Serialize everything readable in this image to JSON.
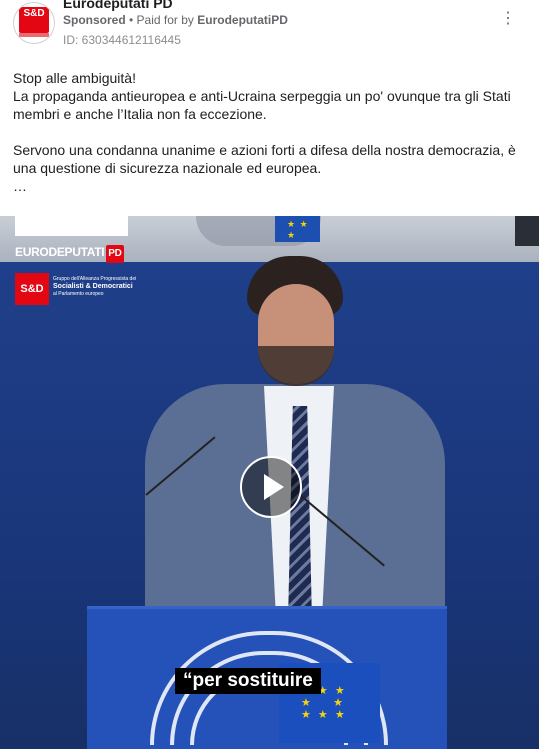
{
  "header": {
    "page_name": "Eurodeputati PD",
    "sponsored": "Sponsored",
    "paid_for_prefix": " • Paid for by ",
    "paid_for_name": "EurodeputatiPD",
    "ad_id": "ID: 630344612116445",
    "more_icon": "more-horizontal-icon"
  },
  "avatar": {
    "logo_text": "S&D"
  },
  "post": {
    "text": "Stop alle ambiguità!\nLa propaganda antieuropea e anti-Ucraina serpeggia un po' ovunque tra gli Stati membri e anche l’Italia non fa eccezione.\n\nServono una condanna unanime e azioni forti a difesa della nostra democrazia, è una questione di sicurezza nazionale ed europea.\n…"
  },
  "video": {
    "brand_prefix": "EURODEPUTATI",
    "brand_badge": "PD",
    "sd_logo": "S&D",
    "sd_line1": "Gruppo dell'Alleanza Progressista dei",
    "sd_line2": "Socialisti & Democratici",
    "sd_line3": "al Parlamento europeo",
    "subtitle": "“per sostituire",
    "play_icon": "play-icon"
  }
}
